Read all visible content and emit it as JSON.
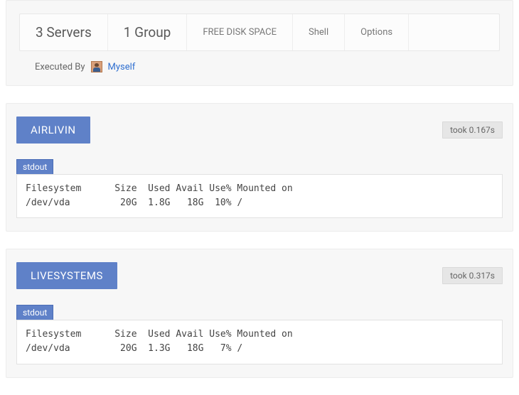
{
  "summary": {
    "servers_label": "3 Servers",
    "group_label": "1 Group",
    "command_label": "FREE DISK SPACE",
    "shell_label": "Shell",
    "options_label": "Options",
    "executed_by_label": "Executed By",
    "executed_by_user": "Myself"
  },
  "results": [
    {
      "server": "AIRLIVIN",
      "took_label": "took 0.167s",
      "stream_label": "stdout",
      "output": "Filesystem      Size  Used Avail Use% Mounted on\n/dev/vda         20G  1.8G   18G  10% /"
    },
    {
      "server": "LIVESYSTEMS",
      "took_label": "took 0.317s",
      "stream_label": "stdout",
      "output": "Filesystem      Size  Used Avail Use% Mounted on\n/dev/vda         20G  1.3G   18G   7% /"
    }
  ]
}
